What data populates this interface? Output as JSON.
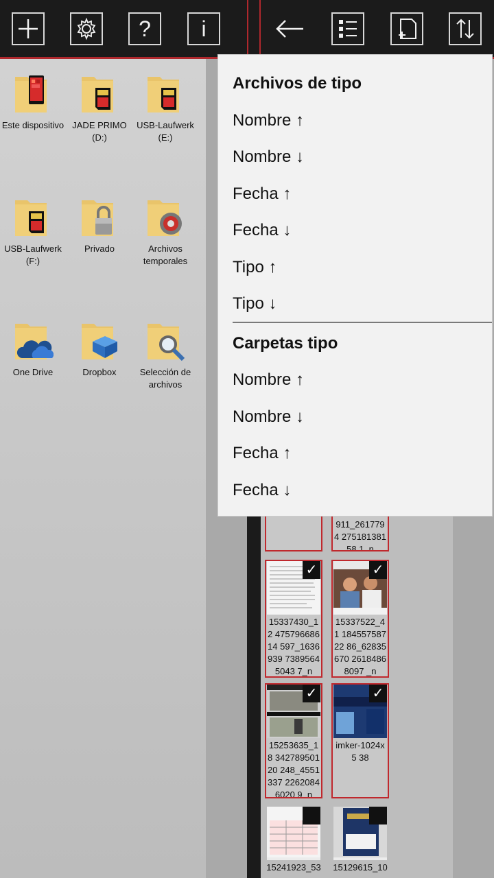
{
  "toolbar_left": {
    "buttons": [
      {
        "icon": "plus-icon"
      },
      {
        "icon": "gear-icon"
      },
      {
        "icon": "question-icon",
        "label": "?"
      },
      {
        "icon": "info-icon",
        "label": "i"
      }
    ]
  },
  "toolbar_right": {
    "buttons": [
      {
        "icon": "back-arrow-icon"
      },
      {
        "icon": "list-view-icon"
      },
      {
        "icon": "new-file-icon"
      },
      {
        "icon": "sort-icon"
      }
    ]
  },
  "folders": [
    {
      "label": "Este dispositivo",
      "icon": "phone-icon"
    },
    {
      "label": "JADE PRIMO (D:)",
      "icon": "sd-card-icon"
    },
    {
      "label": "USB-Laufwerk (E:)",
      "icon": "sd-card-icon"
    },
    {
      "label": "USB-Laufwerk (F:)",
      "icon": "sd-card-icon"
    },
    {
      "label": "Privado",
      "icon": "lock-icon"
    },
    {
      "label": "Archivos temporales",
      "icon": "gear-folder-icon"
    },
    {
      "label": "One Drive",
      "icon": "cloud-icon"
    },
    {
      "label": "Dropbox",
      "icon": "dropbox-icon"
    },
    {
      "label": "Selección de archivos",
      "icon": "magnifier-icon"
    }
  ],
  "files": [
    {
      "caption": "911_2617794 27518138158 1_n"
    },
    {
      "caption": "15337430_12 47579668614 597_1636939 73895645043 7_n"
    },
    {
      "caption": "15337522_41 18455758722 86_62835670 26184868097 _n"
    },
    {
      "caption": "15253635_18 34278950120 248_4551337 22620846020 9_n"
    },
    {
      "caption": "imker-1024x5 38"
    },
    {
      "caption": "15241923_53"
    },
    {
      "caption": "15129615_10"
    }
  ],
  "sort_menu": {
    "files_header": "Archivos de tipo",
    "files_items": [
      "Nombre ↑",
      "Nombre ↓",
      "Fecha ↑",
      "Fecha ↓",
      "Tipo ↑",
      "Tipo ↓"
    ],
    "folders_header": "Carpetas tipo",
    "folders_items": [
      "Nombre ↑",
      "Nombre ↓",
      "Fecha ↑",
      "Fecha ↓"
    ]
  },
  "colors": {
    "accent": "#b0282d",
    "toolbar": "#1b1b1b",
    "menu_bg": "#f2f2f2"
  }
}
